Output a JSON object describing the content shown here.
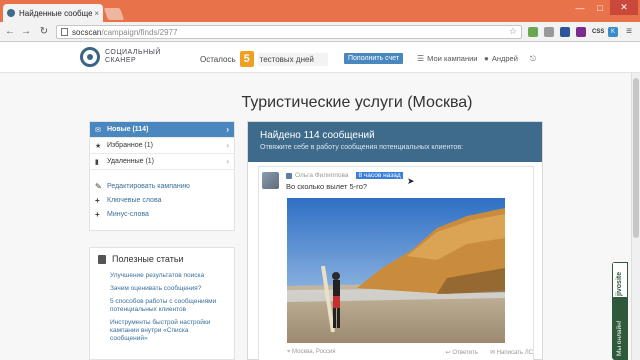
{
  "browser": {
    "tab_title": "Найденные сообщения",
    "tab_close": "×",
    "url_host": "socscan",
    "url_path": "/campaign/finds/2977",
    "window_min": "—",
    "window_max": "□",
    "window_close": "✕",
    "back": "←",
    "forward": "→",
    "reload": "↻",
    "star": "☆",
    "ext_css": "CSS",
    "ext_k": "K",
    "menu": "≡"
  },
  "header": {
    "logo_line1": "СОЦИАЛЬНЫЙ",
    "logo_line2": "СКАНЕР",
    "trial_prefix": "Осталось",
    "trial_days": "5",
    "trial_suffix": "тестовых дней",
    "topup_label": "Пополнить счет",
    "campaigns_label": "Мои кампании",
    "user_label": "Андрей",
    "logout_icon": "⎋"
  },
  "page": {
    "title": "Туристические услуги (Москва)"
  },
  "sidebar": {
    "filters": [
      {
        "label": "Новые (114)",
        "icon": "✉",
        "active": true
      },
      {
        "label": "Избранное (1)",
        "icon": "★",
        "active": false
      },
      {
        "label": "Удаленные (1)",
        "icon": "▮",
        "active": false
      }
    ],
    "actions": [
      {
        "label": "Редактировать кампанию",
        "icon": "✎"
      },
      {
        "label": "Ключевые слова",
        "icon": "+"
      },
      {
        "label": "Минус-слова",
        "icon": "+"
      }
    ],
    "chevron": "›"
  },
  "articles": {
    "title": "Полезные статьи",
    "links": [
      "Улучшение результатов поиска",
      "Зачем оценивать сообщения?",
      "5 способов работы с сообщениями потенциальных клиентов",
      "Инструменты быстрой настройки кампании внутри «Списка сообщений»"
    ]
  },
  "results": {
    "title": "Найдено 114 сообщений",
    "subtitle": "Отвяжите себе в работу сообщения потенциальных клиентов:",
    "post": {
      "author": "Ольга Филиппова",
      "time": "8 часов назад",
      "text": "Во сколько вылет 5-го?",
      "location": "Москва, Россия",
      "reply_label": "Ответить",
      "dm_label": "Написать ЛС"
    }
  },
  "feedback": {
    "brand": "jivosite",
    "label": "Мы онлайн!"
  },
  "colors": {
    "accent": "#4a87be",
    "header_panel": "#3e6a8b",
    "trial_badge": "#f0a020",
    "browser_frame": "#e8734a"
  }
}
